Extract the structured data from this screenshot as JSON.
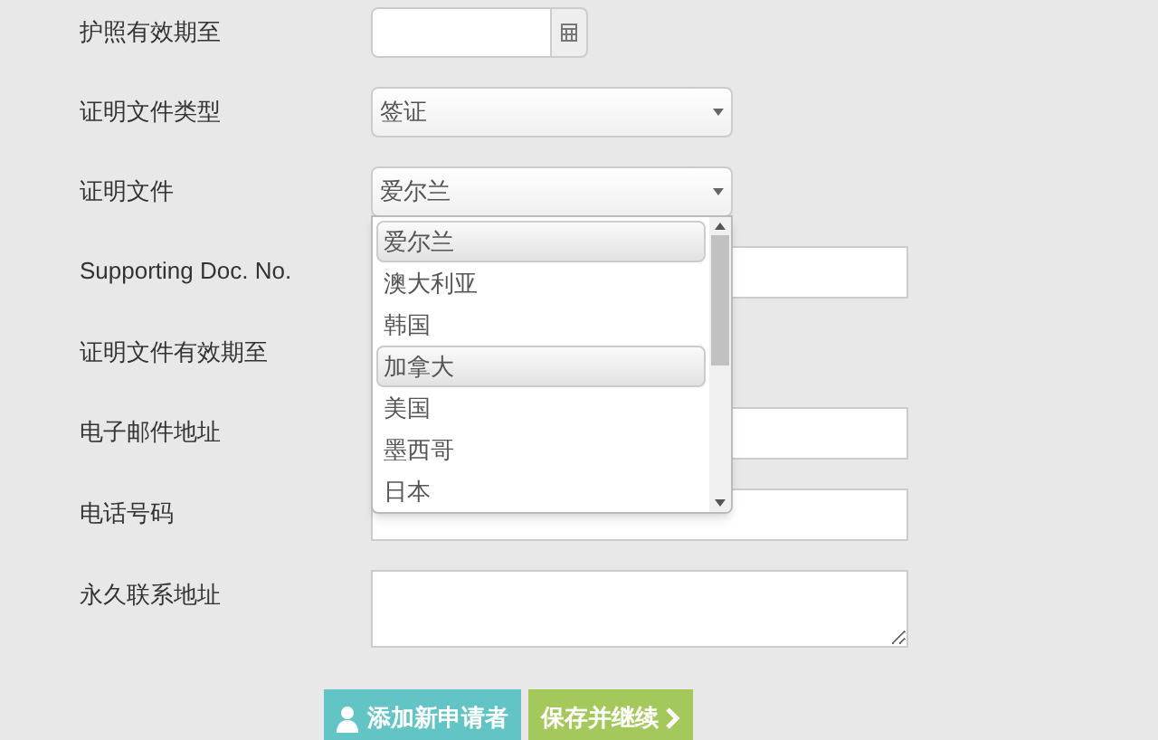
{
  "form": {
    "fields": [
      {
        "label": "护照有效期至",
        "kind": "date"
      },
      {
        "label": "证明文件类型",
        "kind": "select",
        "value": "签证"
      },
      {
        "label": "证明文件",
        "kind": "select",
        "value": "爱尔兰",
        "dropdown": {
          "options": [
            {
              "label": "爱尔兰",
              "selected": true
            },
            {
              "label": "澳大利亚",
              "selected": false
            },
            {
              "label": "韩国",
              "selected": false
            },
            {
              "label": "加拿大",
              "selected": true
            },
            {
              "label": "美国",
              "selected": false
            },
            {
              "label": "墨西哥",
              "selected": false
            },
            {
              "label": "日本",
              "selected": false
            }
          ]
        }
      },
      {
        "label": "Supporting Doc. No.",
        "kind": "text"
      },
      {
        "label": "证明文件有效期至",
        "kind": "hidden"
      },
      {
        "label": "电子邮件地址",
        "kind": "text"
      },
      {
        "label": "电话号码",
        "kind": "text"
      },
      {
        "label": "永久联系地址",
        "kind": "textarea"
      }
    ]
  },
  "buttons": [
    {
      "label": "添加新申请者",
      "kind": "add"
    },
    {
      "label": "保存并继续",
      "kind": "next"
    }
  ]
}
